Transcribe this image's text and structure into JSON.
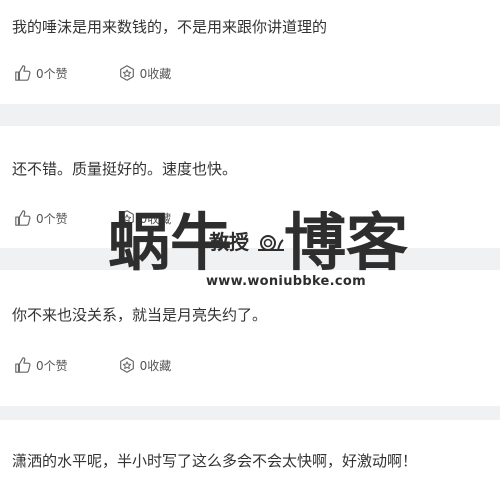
{
  "comments": [
    {
      "text": "我的唾沫是用来数钱的，不是用来跟你讲道理的",
      "likes_label": "0个赞",
      "favorites_label": "0收藏"
    },
    {
      "text": "还不错。质量挺好的。速度也快。",
      "likes_label": "0个赞",
      "favorites_label": "0收藏"
    },
    {
      "text": "你不来也没关系，就当是月亮失约了。",
      "likes_label": "0个赞",
      "favorites_label": "0收藏"
    },
    {
      "text": "潇洒的水平呢，半小时写了这么多会不会太快啊，好激动啊！"
    }
  ],
  "watermark": {
    "brand_part1": "蜗牛",
    "brand_small": "教授",
    "brand_part2": "博客",
    "url": "www.woniubbke.com"
  },
  "icons": {
    "like": "thumbs-up-icon",
    "favorite": "favorite-box-icon"
  }
}
